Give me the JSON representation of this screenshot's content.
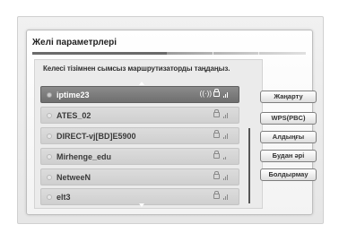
{
  "dialog": {
    "title": "Желі параметрлері",
    "instruction": "Келесі тізімнен сымсыз маршрутизаторды таңдаңыз."
  },
  "networks": [
    {
      "name": "iptime23",
      "selected": true,
      "wps": "((·))",
      "secured": true
    },
    {
      "name": "ATES_02",
      "selected": false,
      "secured": true
    },
    {
      "name": "DIRECT-vj[BD]E5900",
      "selected": false,
      "secured": true
    },
    {
      "name": "Mirhenge_edu",
      "selected": false,
      "secured": true
    },
    {
      "name": "NetweeN",
      "selected": false,
      "secured": true
    },
    {
      "name": "elt3",
      "selected": false,
      "secured": true
    }
  ],
  "buttons": {
    "refresh": "Жаңарту",
    "wps": "WPS(PBC)",
    "previous": "Алдыңғы",
    "next": "Будан әрі",
    "cancel": "Болдырмау"
  }
}
